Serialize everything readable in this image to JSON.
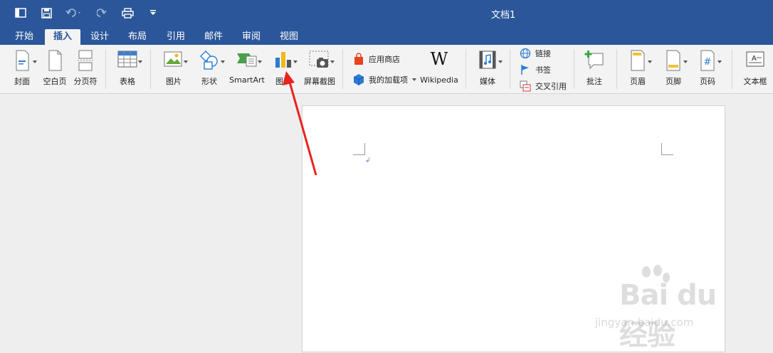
{
  "window": {
    "title": "文档1"
  },
  "tabs": [
    {
      "label": "开始"
    },
    {
      "label": "插入"
    },
    {
      "label": "设计"
    },
    {
      "label": "布局"
    },
    {
      "label": "引用"
    },
    {
      "label": "邮件"
    },
    {
      "label": "审阅"
    },
    {
      "label": "视图"
    }
  ],
  "ribbon": {
    "cover": "封面",
    "blank_page": "空白页",
    "page_break": "分页符",
    "table": "表格",
    "picture": "图片",
    "shape": "形状",
    "smartart": "SmartArt",
    "chart": "图表",
    "screenshot": "屏幕截图",
    "app_store": "应用商店",
    "my_addins": "我的加载项",
    "wikipedia": "Wikipedia",
    "media": "媒体",
    "link": "链接",
    "bookmark": "书签",
    "cross_ref": "交叉引用",
    "comment": "批注",
    "header": "页眉",
    "footer": "页脚",
    "page_number": "页码",
    "textbox": "文本框"
  },
  "document": {
    "paragraph_mark": "↲"
  },
  "watermark": {
    "brand": "Bai du 经验",
    "url": "jingyan.baidu.com"
  },
  "colors": {
    "accent": "#2b579a",
    "arrow": "#e8231f"
  }
}
